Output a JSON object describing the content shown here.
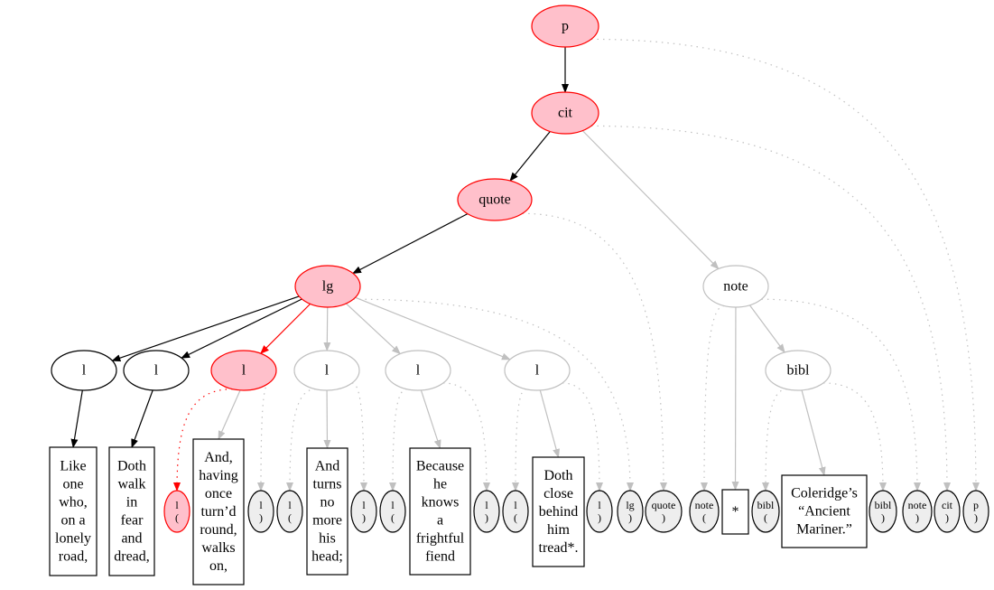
{
  "colors": {
    "highlight_fill": "#ffc0cb",
    "highlight_stroke": "#ff0000",
    "inactive": "#c0c0c0",
    "marker_fill": "#eeeeee",
    "normal": "#000000"
  },
  "nodes": [
    {
      "id": "p",
      "lines": [
        "p"
      ],
      "kind": "hl"
    },
    {
      "id": "cit",
      "lines": [
        "cit"
      ],
      "kind": "hl"
    },
    {
      "id": "quote",
      "lines": [
        "quote"
      ],
      "kind": "hl"
    },
    {
      "id": "lg",
      "lines": [
        "lg"
      ],
      "kind": "hl"
    },
    {
      "id": "note",
      "lines": [
        "note"
      ],
      "kind": "gray"
    },
    {
      "id": "l1",
      "lines": [
        "l"
      ],
      "kind": "black"
    },
    {
      "id": "l2",
      "lines": [
        "l"
      ],
      "kind": "black"
    },
    {
      "id": "l3",
      "lines": [
        "l"
      ],
      "kind": "hl"
    },
    {
      "id": "l4",
      "lines": [
        "l"
      ],
      "kind": "gray"
    },
    {
      "id": "l5",
      "lines": [
        "l"
      ],
      "kind": "gray"
    },
    {
      "id": "l6",
      "lines": [
        "l"
      ],
      "kind": "gray"
    },
    {
      "id": "bibl",
      "lines": [
        "bibl"
      ],
      "kind": "gray"
    },
    {
      "id": "t1",
      "lines": [
        "Like",
        "one",
        "who,",
        "on a",
        "lonely",
        "road,"
      ],
      "kind": "box"
    },
    {
      "id": "t2",
      "lines": [
        "Doth",
        "walk",
        "in",
        "fear",
        "and",
        "dread,"
      ],
      "kind": "box"
    },
    {
      "id": "t3",
      "lines": [
        "And,",
        "having",
        "once",
        "turn’d",
        "round,",
        "walks",
        "on,"
      ],
      "kind": "box"
    },
    {
      "id": "t4",
      "lines": [
        "And",
        "turns",
        "no",
        "more",
        "his",
        "head;"
      ],
      "kind": "box"
    },
    {
      "id": "t5",
      "lines": [
        "Because",
        "he",
        "knows",
        "a",
        "frightful",
        "fiend"
      ],
      "kind": "box"
    },
    {
      "id": "t6",
      "lines": [
        "Doth",
        "close",
        "behind",
        "him",
        "tread*."
      ],
      "kind": "box"
    },
    {
      "id": "t7",
      "lines": [
        "*"
      ],
      "kind": "box"
    },
    {
      "id": "t8",
      "lines": [
        "Coleridge’s",
        "“Ancient",
        "Mariner.”"
      ],
      "kind": "box"
    },
    {
      "id": "m1",
      "lines": [
        "l",
        "("
      ],
      "kind": "mark-hl"
    },
    {
      "id": "m2",
      "lines": [
        "l",
        ")"
      ],
      "kind": "mark"
    },
    {
      "id": "m3",
      "lines": [
        "l",
        "("
      ],
      "kind": "mark"
    },
    {
      "id": "m4",
      "lines": [
        "l",
        ")"
      ],
      "kind": "mark"
    },
    {
      "id": "m5",
      "lines": [
        "l",
        "("
      ],
      "kind": "mark"
    },
    {
      "id": "m6",
      "lines": [
        "l",
        ")"
      ],
      "kind": "mark"
    },
    {
      "id": "m7",
      "lines": [
        "l",
        "("
      ],
      "kind": "mark"
    },
    {
      "id": "m8",
      "lines": [
        "l",
        ")"
      ],
      "kind": "mark"
    },
    {
      "id": "m9",
      "lines": [
        "lg",
        ")"
      ],
      "kind": "mark"
    },
    {
      "id": "m10",
      "lines": [
        "quote",
        ")"
      ],
      "kind": "mark"
    },
    {
      "id": "m11",
      "lines": [
        "note",
        "("
      ],
      "kind": "mark"
    },
    {
      "id": "m12",
      "lines": [
        "bibl",
        "("
      ],
      "kind": "mark"
    },
    {
      "id": "m13",
      "lines": [
        "bibl",
        ")"
      ],
      "kind": "mark"
    },
    {
      "id": "m14",
      "lines": [
        "note",
        ")"
      ],
      "kind": "mark"
    },
    {
      "id": "m15",
      "lines": [
        "cit",
        ")"
      ],
      "kind": "mark"
    },
    {
      "id": "m16",
      "lines": [
        "p",
        ")"
      ],
      "kind": "mark"
    }
  ],
  "edges": [
    {
      "from": "p",
      "to": "cit",
      "style": "black"
    },
    {
      "from": "cit",
      "to": "quote",
      "style": "black"
    },
    {
      "from": "quote",
      "to": "lg",
      "style": "black"
    },
    {
      "from": "lg",
      "to": "l1",
      "style": "black"
    },
    {
      "from": "lg",
      "to": "l2",
      "style": "black"
    },
    {
      "from": "l1",
      "to": "t1",
      "style": "black"
    },
    {
      "from": "l2",
      "to": "t2",
      "style": "black"
    },
    {
      "from": "lg",
      "to": "l3",
      "style": "red"
    },
    {
      "from": "l3",
      "to": "m1",
      "style": "red-dotted"
    },
    {
      "from": "cit",
      "to": "note",
      "style": "gray"
    },
    {
      "from": "lg",
      "to": "l4",
      "style": "gray"
    },
    {
      "from": "lg",
      "to": "l5",
      "style": "gray"
    },
    {
      "from": "lg",
      "to": "l6",
      "style": "gray"
    },
    {
      "from": "l3",
      "to": "t3",
      "style": "gray"
    },
    {
      "from": "l4",
      "to": "t4",
      "style": "gray"
    },
    {
      "from": "l5",
      "to": "t5",
      "style": "gray"
    },
    {
      "from": "l6",
      "to": "t6",
      "style": "gray"
    },
    {
      "from": "note",
      "to": "bibl",
      "style": "gray"
    },
    {
      "from": "note",
      "to": "t7",
      "style": "gray"
    },
    {
      "from": "bibl",
      "to": "t8",
      "style": "gray"
    },
    {
      "from": "l3",
      "to": "m2",
      "style": "gray-dotted"
    },
    {
      "from": "l4",
      "to": "m3",
      "style": "gray-dotted"
    },
    {
      "from": "l4",
      "to": "m4",
      "style": "gray-dotted"
    },
    {
      "from": "l5",
      "to": "m5",
      "style": "gray-dotted"
    },
    {
      "from": "l5",
      "to": "m6",
      "style": "gray-dotted"
    },
    {
      "from": "l6",
      "to": "m7",
      "style": "gray-dotted"
    },
    {
      "from": "l6",
      "to": "m8",
      "style": "gray-dotted"
    },
    {
      "from": "lg",
      "to": "m9",
      "style": "gray-dotted"
    },
    {
      "from": "quote",
      "to": "m10",
      "style": "gray-dotted"
    },
    {
      "from": "note",
      "to": "m11",
      "style": "gray-dotted"
    },
    {
      "from": "bibl",
      "to": "m12",
      "style": "gray-dotted"
    },
    {
      "from": "bibl",
      "to": "m13",
      "style": "gray-dotted"
    },
    {
      "from": "note",
      "to": "m14",
      "style": "gray-dotted"
    },
    {
      "from": "cit",
      "to": "m15",
      "style": "gray-dotted"
    },
    {
      "from": "p",
      "to": "m16",
      "style": "gray-dotted"
    }
  ]
}
